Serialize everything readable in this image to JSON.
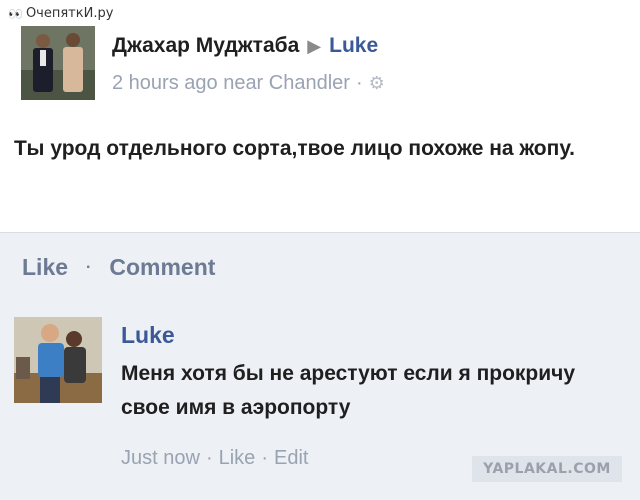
{
  "watermark_top": "ОчепяткИ.ру",
  "post": {
    "author": "Джахар Муджтаба",
    "arrow": "▶",
    "target": "Luke",
    "time": "2 hours ago near Chandler",
    "separator": "·",
    "text": "Ты урод отдельного сорта,твое лицо похоже на жопу."
  },
  "actions": {
    "like": "Like",
    "dot": "·",
    "comment": "Comment"
  },
  "comment": {
    "author": "Luke",
    "text": "Меня хотя бы не арестуют если я прокричу свое имя в аэропорту",
    "time": "Just now",
    "dot1": "·",
    "like": "Like",
    "dot2": "·",
    "edit": "Edit"
  },
  "watermark_bottom": "YAPLAKAL.COM",
  "colors": {
    "link": "#3b5998",
    "meta": "#9aa3b2",
    "action_bar": "#edf0f5"
  }
}
